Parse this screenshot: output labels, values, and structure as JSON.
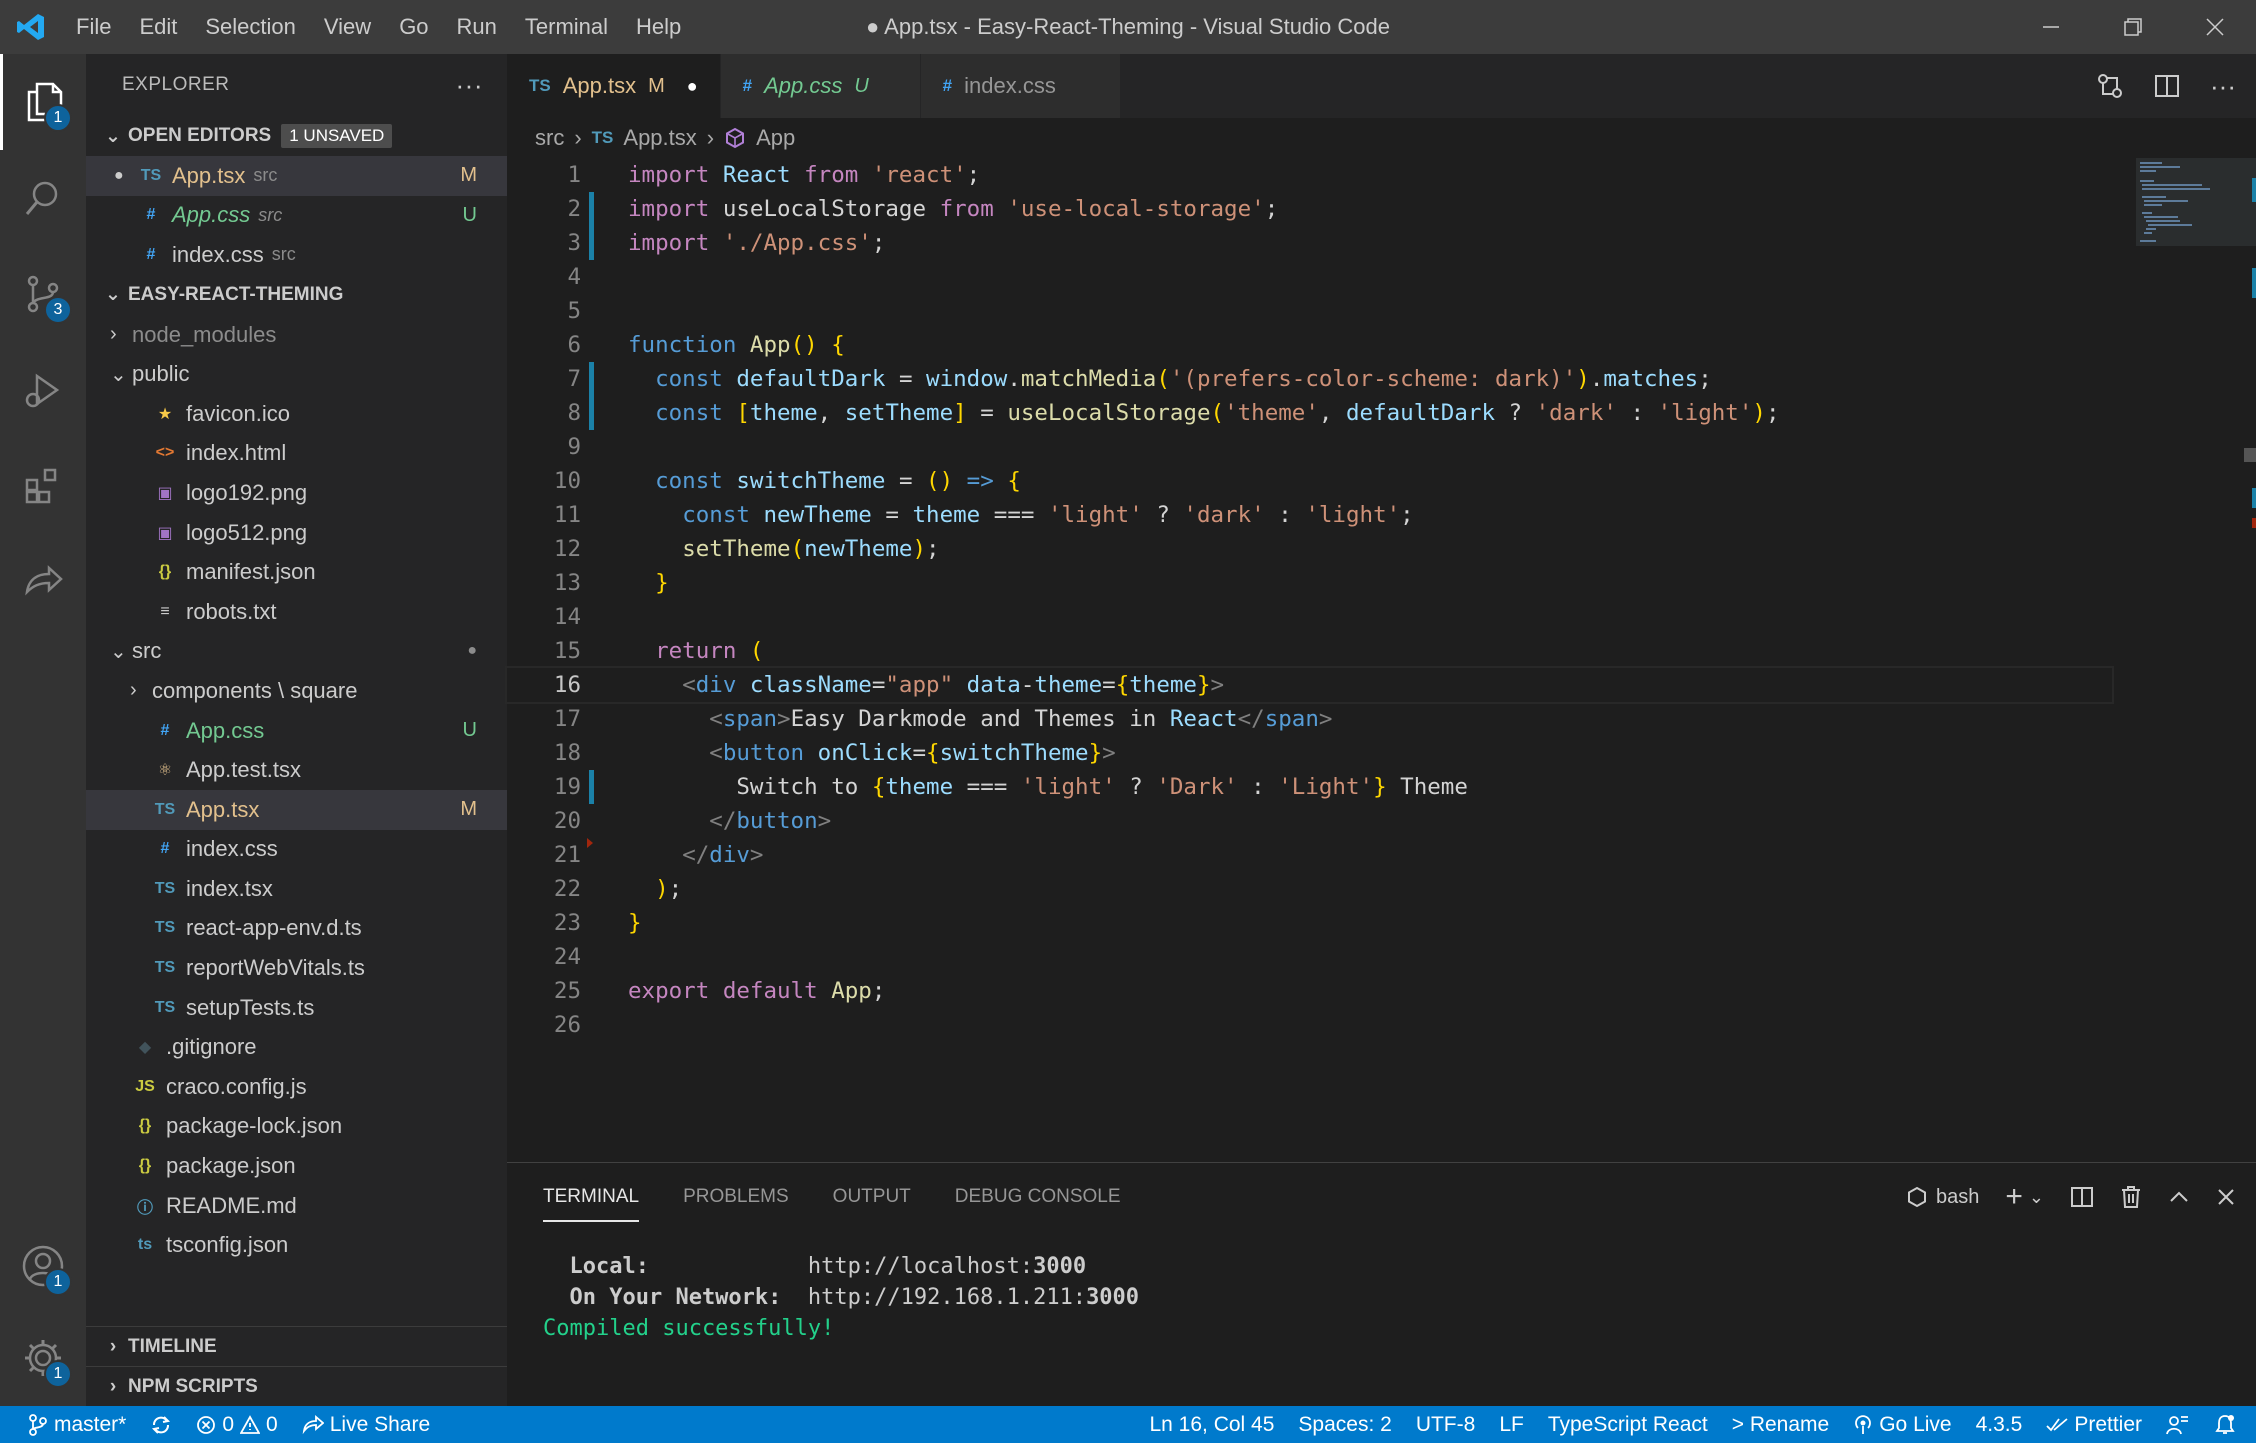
{
  "window": {
    "title": "● App.tsx - Easy-React-Theming - Visual Studio Code"
  },
  "menu": [
    "File",
    "Edit",
    "Selection",
    "View",
    "Go",
    "Run",
    "Terminal",
    "Help"
  ],
  "activity_badges": {
    "explorer": "1",
    "source_control": "3",
    "accounts": "1",
    "settings": "1"
  },
  "explorer": {
    "title": "EXPLORER",
    "open_editors": {
      "label": "OPEN EDITORS",
      "badge": "1 UNSAVED",
      "items": [
        {
          "icon": "TS",
          "name": "App.tsx",
          "desc": "src",
          "status": "M",
          "dirty": "●"
        },
        {
          "icon": "#",
          "name": "App.css",
          "desc": "src",
          "status": "U"
        },
        {
          "icon": "#",
          "name": "index.css",
          "desc": "src",
          "status": ""
        }
      ]
    },
    "project": {
      "label": "EASY-REACT-THEMING",
      "items": [
        {
          "indent": 0,
          "chev": "›",
          "icon": "",
          "name": "node_modules",
          "status": ""
        },
        {
          "indent": 0,
          "chev": "⌄",
          "icon": "",
          "name": "public",
          "status": ""
        },
        {
          "indent": 1,
          "chev": "",
          "icon": "★",
          "name": "favicon.ico",
          "status": ""
        },
        {
          "indent": 1,
          "chev": "",
          "icon": "<>",
          "name": "index.html",
          "status": ""
        },
        {
          "indent": 1,
          "chev": "",
          "icon": "▣",
          "name": "logo192.png",
          "status": ""
        },
        {
          "indent": 1,
          "chev": "",
          "icon": "▣",
          "name": "logo512.png",
          "status": ""
        },
        {
          "indent": 1,
          "chev": "",
          "icon": "{}",
          "name": "manifest.json",
          "status": ""
        },
        {
          "indent": 1,
          "chev": "",
          "icon": "≡",
          "name": "robots.txt",
          "status": ""
        },
        {
          "indent": 0,
          "chev": "⌄",
          "icon": "",
          "name": "src",
          "status": "●"
        },
        {
          "indent": 1,
          "chev": "›",
          "icon": "",
          "name": "components \\ square",
          "status": ""
        },
        {
          "indent": 1,
          "chev": "",
          "icon": "#",
          "name": "App.css",
          "status": "U"
        },
        {
          "indent": 1,
          "chev": "",
          "icon": "⚛",
          "name": "App.test.tsx",
          "status": ""
        },
        {
          "indent": 1,
          "chev": "",
          "icon": "TS",
          "name": "App.tsx",
          "status": "M"
        },
        {
          "indent": 1,
          "chev": "",
          "icon": "#",
          "name": "index.css",
          "status": ""
        },
        {
          "indent": 1,
          "chev": "",
          "icon": "TS",
          "name": "index.tsx",
          "status": ""
        },
        {
          "indent": 1,
          "chev": "",
          "icon": "TS",
          "name": "react-app-env.d.ts",
          "status": ""
        },
        {
          "indent": 1,
          "chev": "",
          "icon": "TS",
          "name": "reportWebVitals.ts",
          "status": ""
        },
        {
          "indent": 1,
          "chev": "",
          "icon": "TS",
          "name": "setupTests.ts",
          "status": ""
        },
        {
          "indent": 0,
          "chev": "",
          "icon": "◆",
          "name": ".gitignore",
          "status": ""
        },
        {
          "indent": 0,
          "chev": "",
          "icon": "JS",
          "name": "craco.config.js",
          "status": ""
        },
        {
          "indent": 0,
          "chev": "",
          "icon": "{}",
          "name": "package-lock.json",
          "status": ""
        },
        {
          "indent": 0,
          "chev": "",
          "icon": "{}",
          "name": "package.json",
          "status": ""
        },
        {
          "indent": 0,
          "chev": "",
          "icon": "ⓘ",
          "name": "README.md",
          "status": ""
        },
        {
          "indent": 0,
          "chev": "",
          "icon": "ts",
          "name": "tsconfig.json",
          "status": ""
        }
      ]
    },
    "timeline": "TIMELINE",
    "npm_scripts": "NPM SCRIPTS"
  },
  "tabs": [
    {
      "icon": "TS",
      "name": "App.tsx",
      "status": "M",
      "dirty": "●",
      "active": true
    },
    {
      "icon": "#",
      "name": "App.css",
      "status": "U",
      "active": false
    },
    {
      "icon": "#",
      "name": "index.css",
      "status": "",
      "active": false
    }
  ],
  "breadcrumb": {
    "folder": "src",
    "file_icon": "TS",
    "file": "App.tsx",
    "symbol": "App"
  },
  "code": {
    "current_line": 16,
    "lines": [
      "import React from 'react';",
      "import useLocalStorage from 'use-local-storage';",
      "import './App.css';",
      "",
      "",
      "function App() {",
      "  const defaultDark = window.matchMedia('(prefers-color-scheme: dark)').matches;",
      "  const [theme, setTheme] = useLocalStorage('theme', defaultDark ? 'dark' : 'light');",
      "",
      "  const switchTheme = () => {",
      "    const newTheme = theme === 'light' ? 'dark' : 'light';",
      "    setTheme(newTheme);",
      "  }",
      "",
      "  return (",
      "    <div className=\"app\" data-theme={theme}>",
      "      <span>Easy Darkmode and Themes in React</span>",
      "      <button onClick={switchTheme}>",
      "        Switch to {theme === 'light' ? 'Dark' : 'Light'} Theme",
      "      </button>",
      "    </div>",
      "  );",
      "}",
      "",
      "export default App;",
      ""
    ]
  },
  "panel": {
    "tabs": [
      "TERMINAL",
      "PROBLEMS",
      "OUTPUT",
      "DEBUG CONSOLE"
    ],
    "shell": "bash",
    "terminal_lines": [
      {
        "label": "  Local:            ",
        "url": "http://localhost:",
        "port": "3000"
      },
      {
        "label": "  On Your Network:  ",
        "url": "http://192.168.1.211:",
        "port": "3000"
      }
    ],
    "compiled": "Compiled successfully!"
  },
  "status": {
    "branch": "master*",
    "errors": "0",
    "warnings": "0",
    "live_share": "Live Share",
    "position": "Ln 16, Col 45",
    "spaces": "Spaces: 2",
    "encoding": "UTF-8",
    "eol": "LF",
    "language": "TypeScript React",
    "rename": "> Rename",
    "go_live": "Go Live",
    "version": "4.3.5",
    "prettier": "Prettier"
  },
  "colors": {
    "accent": "#007acc",
    "ts_icon": "#519aba",
    "modified": "#e2c08d",
    "untracked": "#73c991"
  }
}
